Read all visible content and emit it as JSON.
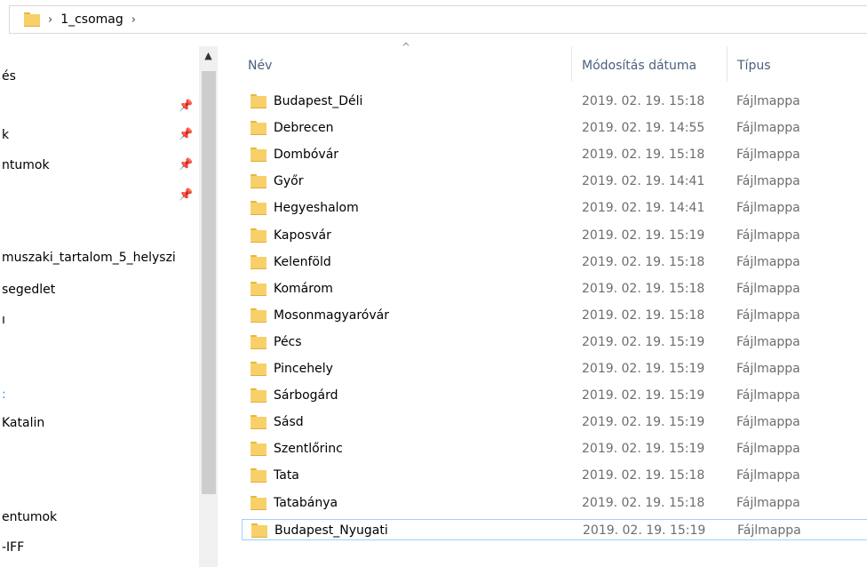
{
  "addressbar": {
    "chevron": "›",
    "path": [
      "1_csomag"
    ],
    "folder_icon": "folder-icon"
  },
  "sidebar": {
    "items": [
      {
        "label": "és",
        "pinned": false
      },
      {
        "label": "",
        "pinned": true
      },
      {
        "label": "k",
        "pinned": true
      },
      {
        "label": "ntumok",
        "pinned": true
      },
      {
        "label": "",
        "pinned": true
      },
      {
        "label": "muszaki_tartalom_5_helyszi",
        "pinned": false
      },
      {
        "label": "segedlet",
        "pinned": false
      },
      {
        "label": "ı",
        "pinned": false
      },
      {
        "label": ":",
        "pinned": false
      },
      {
        "label": "Katalin",
        "pinned": false
      },
      {
        "label": "entumok",
        "pinned": false
      },
      {
        "label": "-IFF",
        "pinned": false
      }
    ],
    "pin_icon": "pin-icon"
  },
  "scrollbar": {
    "up_arrow": "▲"
  },
  "list": {
    "sort_indicator": "^",
    "columns": {
      "name": "Név",
      "modified": "Módosítás dátuma",
      "type": "Típus"
    },
    "rows": [
      {
        "name": "Budapest_Déli",
        "modified": "2019. 02. 19. 15:18",
        "type": "Fájlmappa"
      },
      {
        "name": "Debrecen",
        "modified": "2019. 02. 19. 14:55",
        "type": "Fájlmappa"
      },
      {
        "name": "Dombóvár",
        "modified": "2019. 02. 19. 15:18",
        "type": "Fájlmappa"
      },
      {
        "name": "Győr",
        "modified": "2019. 02. 19. 14:41",
        "type": "Fájlmappa"
      },
      {
        "name": "Hegyeshalom",
        "modified": "2019. 02. 19. 14:41",
        "type": "Fájlmappa"
      },
      {
        "name": "Kaposvár",
        "modified": "2019. 02. 19. 15:19",
        "type": "Fájlmappa"
      },
      {
        "name": "Kelenföld",
        "modified": "2019. 02. 19. 15:18",
        "type": "Fájlmappa"
      },
      {
        "name": "Komárom",
        "modified": "2019. 02. 19. 15:18",
        "type": "Fájlmappa"
      },
      {
        "name": "Mosonmagyaróvár",
        "modified": "2019. 02. 19. 15:18",
        "type": "Fájlmappa"
      },
      {
        "name": "Pécs",
        "modified": "2019. 02. 19. 15:19",
        "type": "Fájlmappa"
      },
      {
        "name": "Pincehely",
        "modified": "2019. 02. 19. 15:19",
        "type": "Fájlmappa"
      },
      {
        "name": "Sárbogárd",
        "modified": "2019. 02. 19. 15:19",
        "type": "Fájlmappa"
      },
      {
        "name": "Sásd",
        "modified": "2019. 02. 19. 15:19",
        "type": "Fájlmappa"
      },
      {
        "name": "Szentlőrinc",
        "modified": "2019. 02. 19. 15:19",
        "type": "Fájlmappa"
      },
      {
        "name": "Tata",
        "modified": "2019. 02. 19. 15:18",
        "type": "Fájlmappa"
      },
      {
        "name": "Tatabánya",
        "modified": "2019. 02. 19. 15:18",
        "type": "Fájlmappa"
      },
      {
        "name": "Budapest_Nyugati",
        "modified": "2019. 02. 19. 15:19",
        "type": "Fájlmappa",
        "selected": true
      }
    ]
  },
  "colors": {
    "folder": "#f8d06a",
    "folder_dark": "#e8b640",
    "header_text": "#4c607a",
    "meta_text": "#6d6d6d",
    "selection_border": "#99d1ff"
  }
}
